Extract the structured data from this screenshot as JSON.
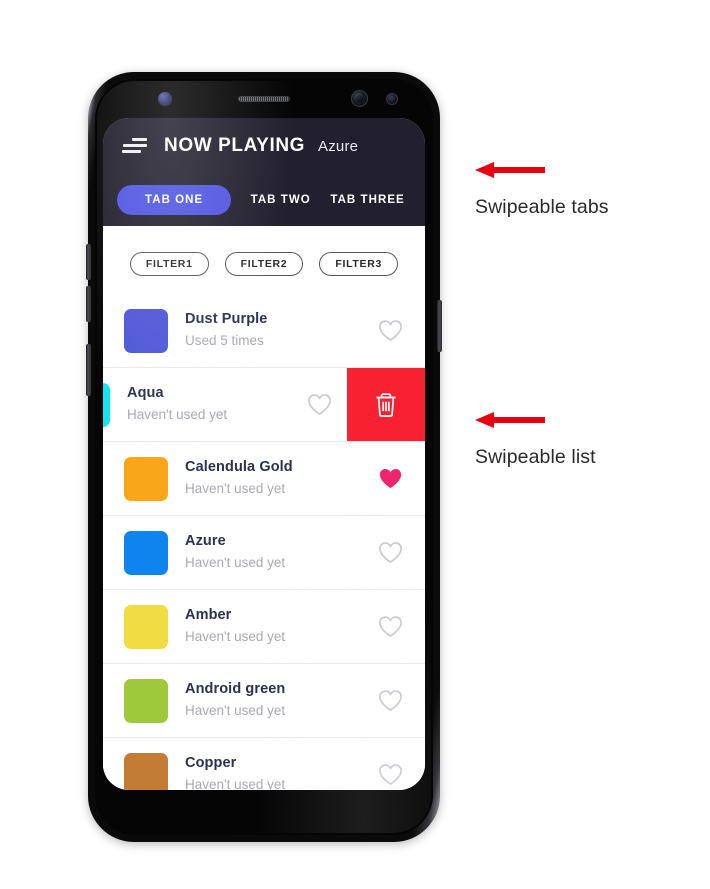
{
  "appbar": {
    "menu_icon": "hamburger-icon",
    "title": "NOW PLAYING",
    "subtitle": "Azure"
  },
  "tabs": [
    {
      "label": "TAB ONE",
      "active": true
    },
    {
      "label": "TAB TWO",
      "active": false
    },
    {
      "label": "TAB THREE",
      "active": false
    }
  ],
  "filters": [
    {
      "label": "FILTER1"
    },
    {
      "label": "FILTER2"
    },
    {
      "label": "FILTER3"
    }
  ],
  "list": {
    "items": [
      {
        "name": "Dust Purple",
        "usage": "Used 5 times",
        "color": "#4e57d8",
        "favorited": false,
        "swiped": false
      },
      {
        "name": "Aqua",
        "usage": "Haven't used yet",
        "color": "#10e6f2",
        "favorited": false,
        "swiped": true,
        "delete_label": "trash-icon"
      },
      {
        "name": "Calendula Gold",
        "usage": "Haven't used yet",
        "color": "#faa61a",
        "favorited": true,
        "swiped": false
      },
      {
        "name": "Azure",
        "usage": "Haven't used yet",
        "color": "#0d84ee",
        "favorited": false,
        "swiped": false
      },
      {
        "name": "Amber",
        "usage": "Haven't used yet",
        "color": "#f2dc44",
        "favorited": false,
        "swiped": false
      },
      {
        "name": "Android green",
        "usage": "Haven't used yet",
        "color": "#9dc93b",
        "favorited": false,
        "swiped": false
      },
      {
        "name": "Copper",
        "usage": "Haven't used yet",
        "color": "#c27c34",
        "favorited": false,
        "swiped": false
      }
    ]
  },
  "annotations": [
    {
      "id": "tabs",
      "label": "Swipeable tabs"
    },
    {
      "id": "list",
      "label": "Swipeable list"
    }
  ],
  "colors": {
    "accent": "#4f55e2",
    "appbar_bg": "#22202e",
    "delete_bg": "#f72131",
    "favorite": "#f0256f",
    "annotation": "#e60012"
  }
}
